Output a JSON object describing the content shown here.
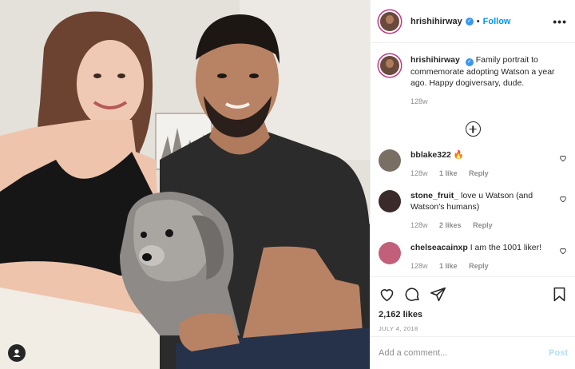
{
  "photo": {
    "alt_icon": "user-tag-icon"
  },
  "header": {
    "username": "hrishihirway",
    "verified_icon": "verified-badge-icon",
    "separator": "•",
    "follow_label": "Follow",
    "more_label": "•••"
  },
  "caption": {
    "username": "hrishihirway",
    "text": "Family portrait to commemorate adopting Watson a year ago. Happy dogiversary, dude.",
    "time": "128w"
  },
  "load_more_icon": "plus-circle-icon",
  "comments": [
    {
      "username": "bblake322",
      "text": "🔥",
      "time": "128w",
      "likes": "1 like",
      "reply": "Reply",
      "avatar_color": "#7a6f64"
    },
    {
      "username": "stone_fruit_",
      "text": "love u Watson (and Watson's humans)",
      "time": "128w",
      "likes": "2 likes",
      "reply": "Reply",
      "avatar_color": "#3a2a2a"
    },
    {
      "username": "chelseacainxp",
      "text": "I am the 1001 liker!",
      "time": "128w",
      "likes": "1 like",
      "reply": "Reply",
      "avatar_color": "#c2607a"
    }
  ],
  "actions": {
    "icons": [
      "heart-icon",
      "comment-icon",
      "share-icon",
      "bookmark-icon"
    ],
    "likes": "2,162 likes",
    "date": "JULY 4, 2018"
  },
  "composer": {
    "placeholder": "Add a comment...",
    "post_label": "Post"
  },
  "colors": {
    "link_blue": "#0095f6",
    "post_disabled": "#b2dffc",
    "muted": "#8e8e8e"
  }
}
